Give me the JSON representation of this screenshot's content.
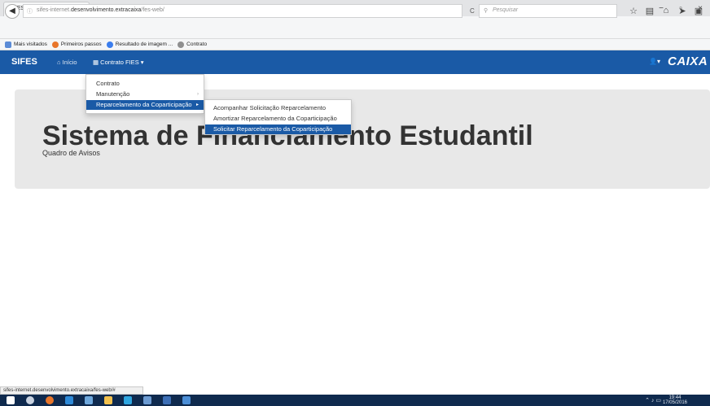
{
  "browser": {
    "tab_title": "SIFES - Sistema de Financiame...",
    "tab_close": "×",
    "new_tab": "+",
    "window_controls": [
      "−",
      "▫",
      "×"
    ],
    "url_prefix": "sifes-internet.",
    "url_domain": "desenvolvimento.extracaixa",
    "url_path": "/fes-web/",
    "search_placeholder": "Pesquisar",
    "bookmarks": [
      {
        "label": "Mais visitados",
        "icon": "bookmark-folder-icon",
        "color": "#5b8bd6"
      },
      {
        "label": "Primeiros passos",
        "icon": "firefox-icon",
        "color": "#e8762b"
      },
      {
        "label": "Resultado de imagem ...",
        "icon": "google-icon",
        "color": "#3b7ded"
      },
      {
        "label": "Contrato",
        "icon": "page-icon",
        "color": "#8f8f8f"
      }
    ]
  },
  "app": {
    "brand": "SIFES",
    "nav_home": "Início",
    "nav_contrato": "Contrato FIES",
    "user_caret": "▾",
    "logo": "CAIXA",
    "colors": {
      "navbar": "#1a5aa6",
      "active": "#1a5aa6"
    }
  },
  "menu": {
    "items": [
      {
        "label": "Contrato",
        "has_submenu": false
      },
      {
        "label": "Manutenção",
        "has_submenu": true
      },
      {
        "label": "Reparcelamento da Coparticipação",
        "has_submenu": true,
        "active": true
      }
    ],
    "submenu": [
      {
        "label": "Acompanhar Solicitação Reparcelamento"
      },
      {
        "label": "Amortizar Reparcelamento da Coparticipação"
      },
      {
        "label": "Solicitar Reparcelamento da Coparticipação",
        "active": true
      }
    ]
  },
  "page": {
    "title": "Sistema de Financiamento Estudantil",
    "subtitle": "Quadro de Avisos"
  },
  "status_url": "sifes-internet.desenvolvimento.extracaixa/fes-web/#",
  "taskbar": {
    "time": "19:44",
    "date": "17/05/2016"
  }
}
